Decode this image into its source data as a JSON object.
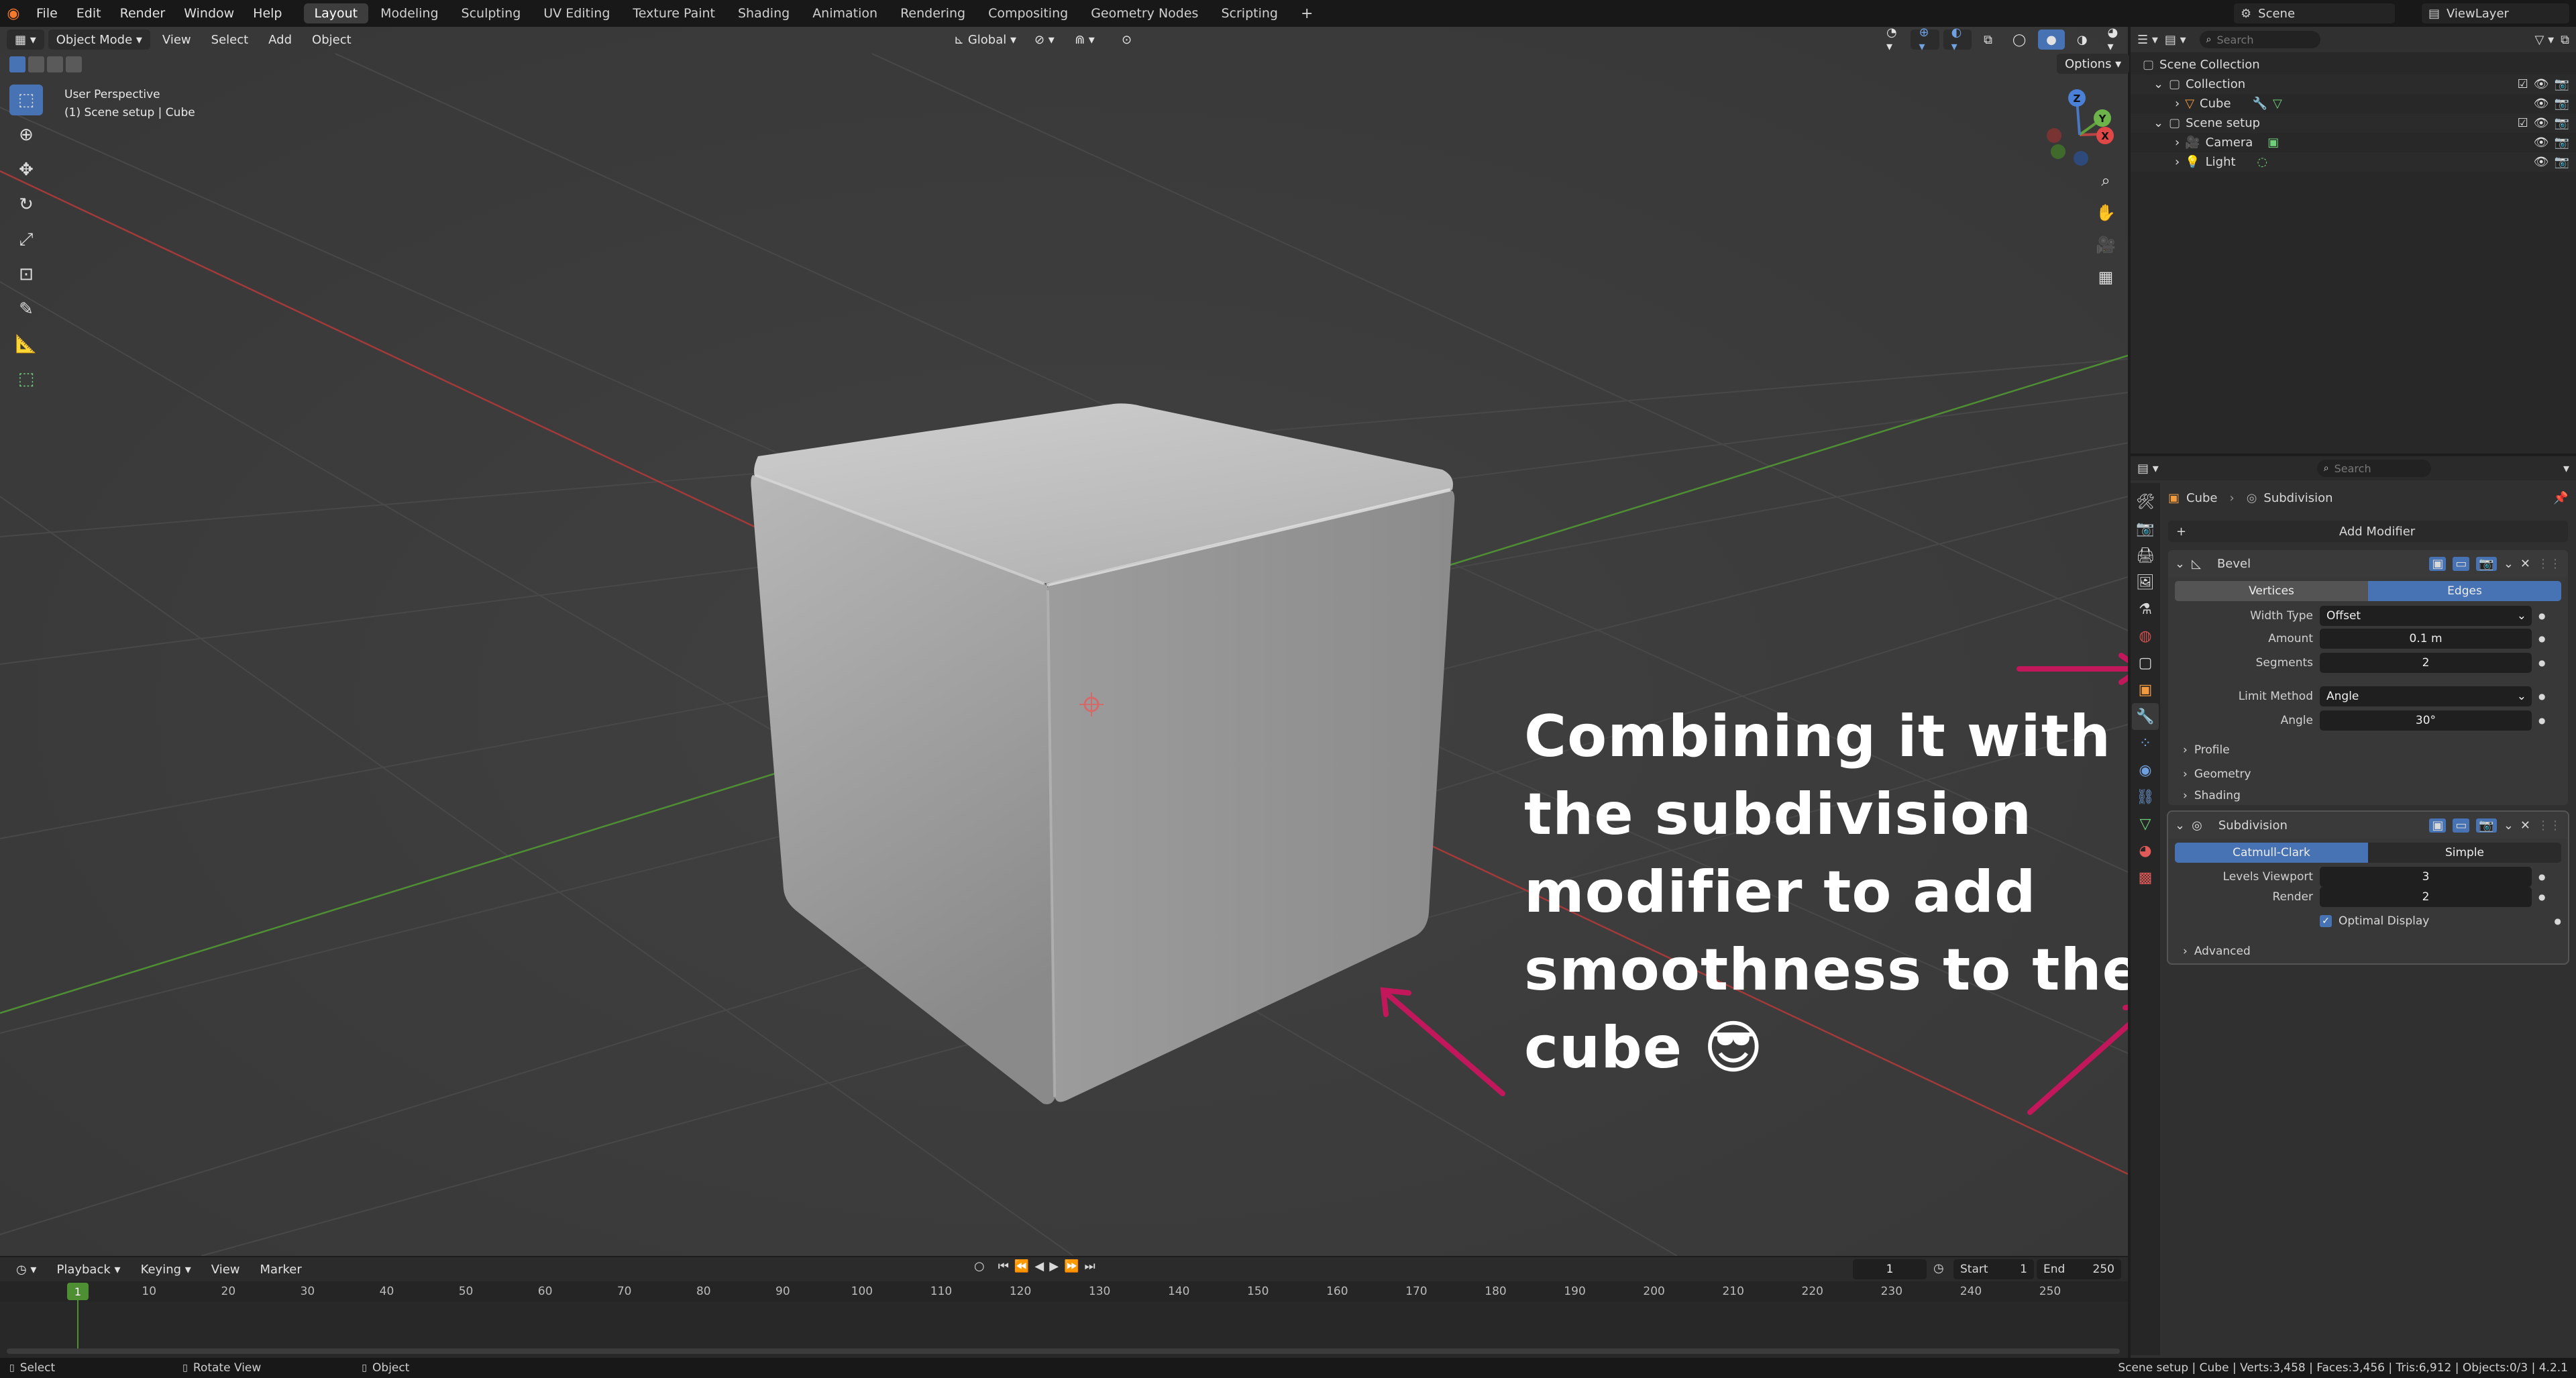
{
  "topbar": {
    "menu": [
      "File",
      "Edit",
      "Render",
      "Window",
      "Help"
    ],
    "workspaces": [
      "Layout",
      "Modeling",
      "Sculpting",
      "UV Editing",
      "Texture Paint",
      "Shading",
      "Animation",
      "Rendering",
      "Compositing",
      "Geometry Nodes",
      "Scripting"
    ],
    "active_workspace": "Layout",
    "scene": "Scene",
    "view_layer": "ViewLayer"
  },
  "viewport": {
    "mode": "Object Mode",
    "menus": [
      "View",
      "Select",
      "Add",
      "Object"
    ],
    "transform_orientation": "Global",
    "options_label": "Options",
    "info_line1": "User Perspective",
    "info_line2": "(1) Scene setup | Cube",
    "gizmo_axes": [
      "X",
      "Y",
      "Z"
    ]
  },
  "caption": {
    "lines": [
      "Combining it with",
      "the subdivision",
      "modifier to add",
      "smoothness to the",
      "cube 😎"
    ]
  },
  "outliner": {
    "search_placeholder": "Search",
    "rows": [
      {
        "label": "Scene Collection",
        "indent": 0
      },
      {
        "label": "Collection",
        "indent": 1
      },
      {
        "label": "Cube",
        "indent": 2
      },
      {
        "label": "Scene setup",
        "indent": 1
      },
      {
        "label": "Camera",
        "indent": 2
      },
      {
        "label": "Light",
        "indent": 2
      }
    ]
  },
  "properties": {
    "search_placeholder": "Search",
    "breadcrumb_object": "Cube",
    "breadcrumb_modifier": "Subdivision",
    "add_modifier": "Add Modifier",
    "bevel": {
      "name": "Bevel",
      "mode_a": "Vertices",
      "mode_b": "Edges",
      "width_type_label": "Width Type",
      "width_type_value": "Offset",
      "amount_label": "Amount",
      "amount_value": "0.1 m",
      "segments_label": "Segments",
      "segments_value": "2",
      "limit_method_label": "Limit Method",
      "limit_method_value": "Angle",
      "angle_label": "Angle",
      "angle_value": "30°",
      "subpanels": [
        "Profile",
        "Geometry",
        "Shading"
      ]
    },
    "subdivision": {
      "name": "Subdivision",
      "mode_a": "Catmull-Clark",
      "mode_b": "Simple",
      "levels_viewport_label": "Levels Viewport",
      "levels_viewport_value": "3",
      "render_label": "Render",
      "render_value": "2",
      "optimal_display_label": "Optimal Display",
      "optimal_display_checked": true,
      "advanced_label": "Advanced"
    }
  },
  "timeline": {
    "menus": [
      "Playback",
      "Keying",
      "View",
      "Marker"
    ],
    "current_frame": "1",
    "start_label": "Start",
    "start_value": "1",
    "end_label": "End",
    "end_value": "250",
    "ticks": [
      "1",
      "10",
      "20",
      "30",
      "40",
      "50",
      "60",
      "70",
      "80",
      "90",
      "100",
      "110",
      "120",
      "130",
      "140",
      "150",
      "160",
      "170",
      "180",
      "190",
      "200",
      "210",
      "220",
      "230",
      "240",
      "250"
    ]
  },
  "statusbar": {
    "select": "Select",
    "rotate": "Rotate View",
    "object": "Object",
    "stats": "Scene setup | Cube | Verts:3,458 | Faces:3,456 | Tris:6,912 | Objects:0/3 | 4.2.1"
  },
  "colors": {
    "accent": "#4772b3",
    "arrow": "#c2185b",
    "x_axis": "#a33a3a",
    "y_axis": "#4f8f34"
  }
}
